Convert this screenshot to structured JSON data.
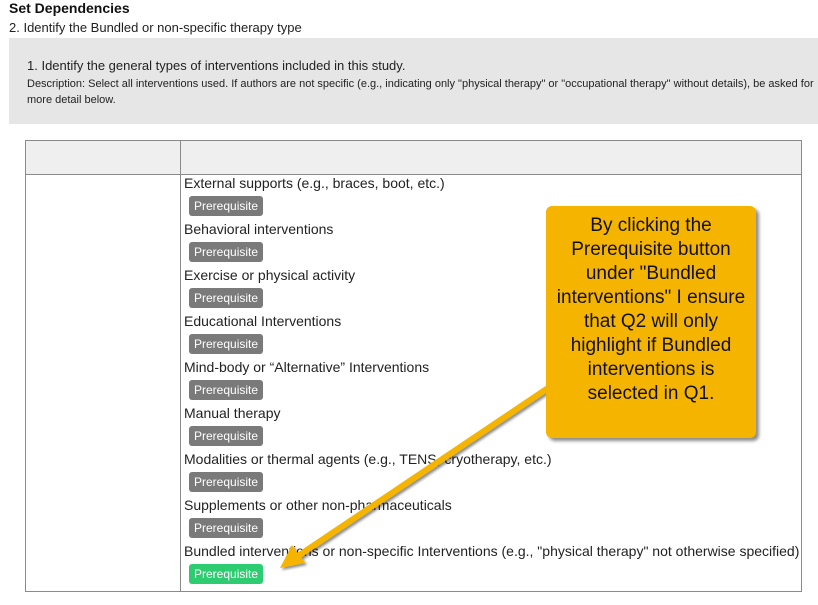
{
  "header": {
    "title": "Set Dependencies",
    "subtitle": "2. Identify the Bundled or non-specific therapy type"
  },
  "question": {
    "text": "1. Identify the general types of interventions included in this study.",
    "description": "Description: Select all interventions used. If authors are not specific (e.g., indicating only \"physical therapy\" or \"occupational therapy\" without details), be asked for more detail below."
  },
  "prerequisite_label": "Prerequisite",
  "items": [
    {
      "label": "External supports (e.g., braces, boot, etc.)",
      "button": "Prerequisite",
      "active": false
    },
    {
      "label": "Behavioral interventions",
      "button": "Prerequisite",
      "active": false
    },
    {
      "label": "Exercise or physical activity",
      "button": "Prerequisite",
      "active": false
    },
    {
      "label": "Educational Interventions",
      "button": "Prerequisite",
      "active": false
    },
    {
      "label": "Mind-body or “Alternative” Interventions",
      "button": "Prerequisite",
      "active": false
    },
    {
      "label": "Manual therapy",
      "button": "Prerequisite",
      "active": false
    },
    {
      "label": "Modalities or thermal agents (e.g., TENS, cryotherapy, etc.)",
      "button": "Prerequisite",
      "active": false
    },
    {
      "label": "Supplements or other non-pharmaceuticals",
      "button": "Prerequisite",
      "active": false
    },
    {
      "label": "Bundled interventions or non-specific Interventions (e.g., \"physical therapy\" not otherwise specified)",
      "button": "Prerequisite",
      "active": true
    }
  ],
  "callout": {
    "text": "By clicking the Prerequisite button under \"Bundled interventions\" I ensure that Q2 will only highlight if Bundled interventions is selected in Q1."
  },
  "colors": {
    "button_default": "#7a7a7a",
    "button_active": "#2ecc71",
    "callout": "#f5b400",
    "question_bg": "#e6e6e6"
  }
}
